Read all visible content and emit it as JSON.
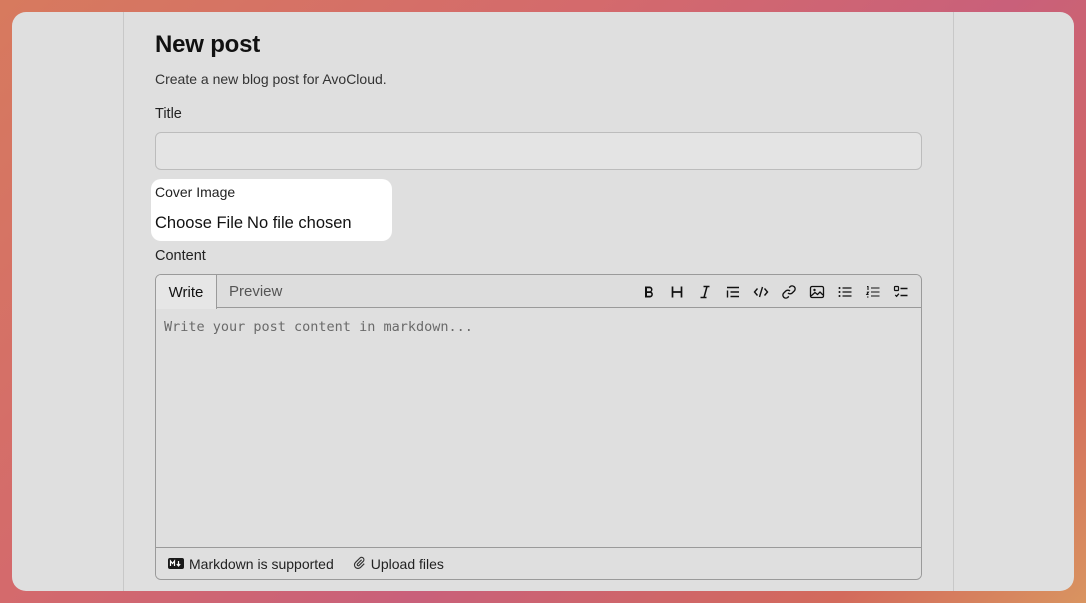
{
  "page": {
    "title": "New post",
    "subtitle": "Create a new blog post for AvoCloud."
  },
  "form": {
    "title_label": "Title",
    "title_value": "",
    "cover_label": "Cover Image",
    "file_button": "Choose File",
    "file_status": "No file chosen",
    "content_label": "Content"
  },
  "editor": {
    "tabs": [
      {
        "label": "Write",
        "active": true
      },
      {
        "label": "Preview",
        "active": false
      }
    ],
    "toolbar": [
      "bold-icon",
      "heading-icon",
      "italic-icon",
      "quote-icon",
      "code-icon",
      "link-icon",
      "image-icon",
      "unordered-list-icon",
      "ordered-list-icon",
      "task-list-icon"
    ],
    "placeholder": "Write your post content in markdown...",
    "footer": {
      "markdown_note": "Markdown is supported",
      "upload_label": "Upload files"
    }
  }
}
